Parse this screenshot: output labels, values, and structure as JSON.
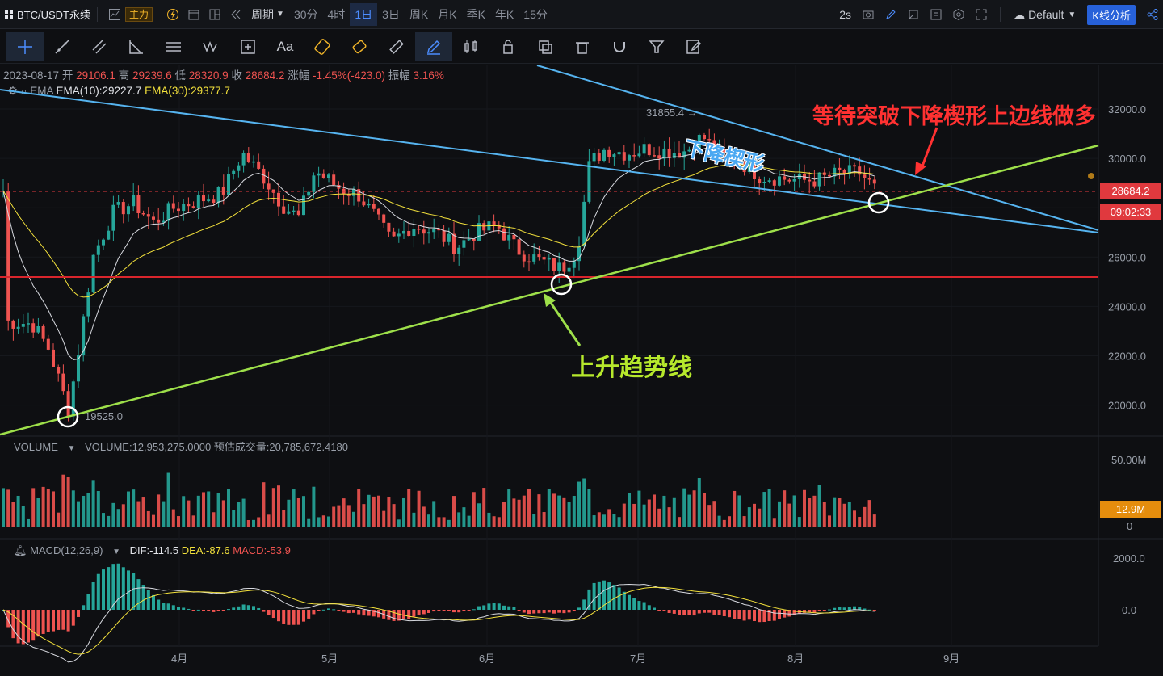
{
  "topbar": {
    "symbol": "BTC/USDT永续",
    "main_label": "主力",
    "period_label": "周期",
    "intervals": [
      "30分",
      "4时",
      "1日",
      "3日",
      "周K",
      "月K",
      "季K",
      "年K",
      "15分"
    ],
    "active_interval": "1日",
    "refresh": "2s",
    "theme": "Default",
    "kline_button": "K线分析"
  },
  "toolbar": {
    "text_tool": "Aa",
    "icons": [
      "crosshair-icon",
      "trend-line-icon",
      "parallel-channel-icon",
      "fib-icon",
      "horizontal-lines-icon",
      "wave-icon",
      "rect-measure-icon",
      "text-icon",
      "brush-icon",
      "eraser-icon",
      "ruler-icon",
      "pen-icon",
      "candle-icon",
      "lock-icon",
      "copy-icon",
      "trash-icon",
      "magnet-icon",
      "filter-icon",
      "edit-icon"
    ]
  },
  "ohlc": {
    "date": "2023-08-17",
    "open_label": "开",
    "open": "29106.1",
    "high_label": "高",
    "high": "29239.6",
    "low_label": "低",
    "low": "28320.9",
    "close_label": "收",
    "close": "28684.2",
    "change_label": "涨幅",
    "change": "-1.45%(-423.0)",
    "amplitude_label": "振幅",
    "amplitude": "3.16%"
  },
  "ema": {
    "name": "EMA",
    "ema10": "EMA(10):29227.7",
    "ema30": "EMA(30):29377.7"
  },
  "volume": {
    "name": "VOLUME",
    "value": "VOLUME:12,953,275.0000",
    "estimate": "预估成交量:20,785,672.4180",
    "tag": "12.9M",
    "axis": [
      "50.00M",
      "0"
    ]
  },
  "macd": {
    "name": "MACD(12,26,9)",
    "dif": "DIF:-114.5",
    "dea": "DEA:-87.6",
    "macd": "MACD:-53.9",
    "axis": [
      "2000.0",
      "0.0"
    ]
  },
  "price_axis": [
    "32000.0",
    "30000.0",
    "28000.0",
    "26000.0",
    "24000.0",
    "22000.0",
    "20000.0"
  ],
  "price_tag": "28684.2",
  "countdown_tag": "09:02:33",
  "x_axis": [
    "4月",
    "5月",
    "6月",
    "7月",
    "8月",
    "9月"
  ],
  "markers": {
    "high": "31855.4",
    "low": "19525.0"
  },
  "annotations": {
    "top": "等待突破下降楔形上边线做多",
    "trend": "上升趋势线",
    "wedge": "下降楔形"
  },
  "colors": {
    "up": "#26a69a",
    "down": "#ef5350",
    "wedge_line": "#56b4f0",
    "trend_line": "#9ee04a",
    "support": "#d9252c"
  }
}
